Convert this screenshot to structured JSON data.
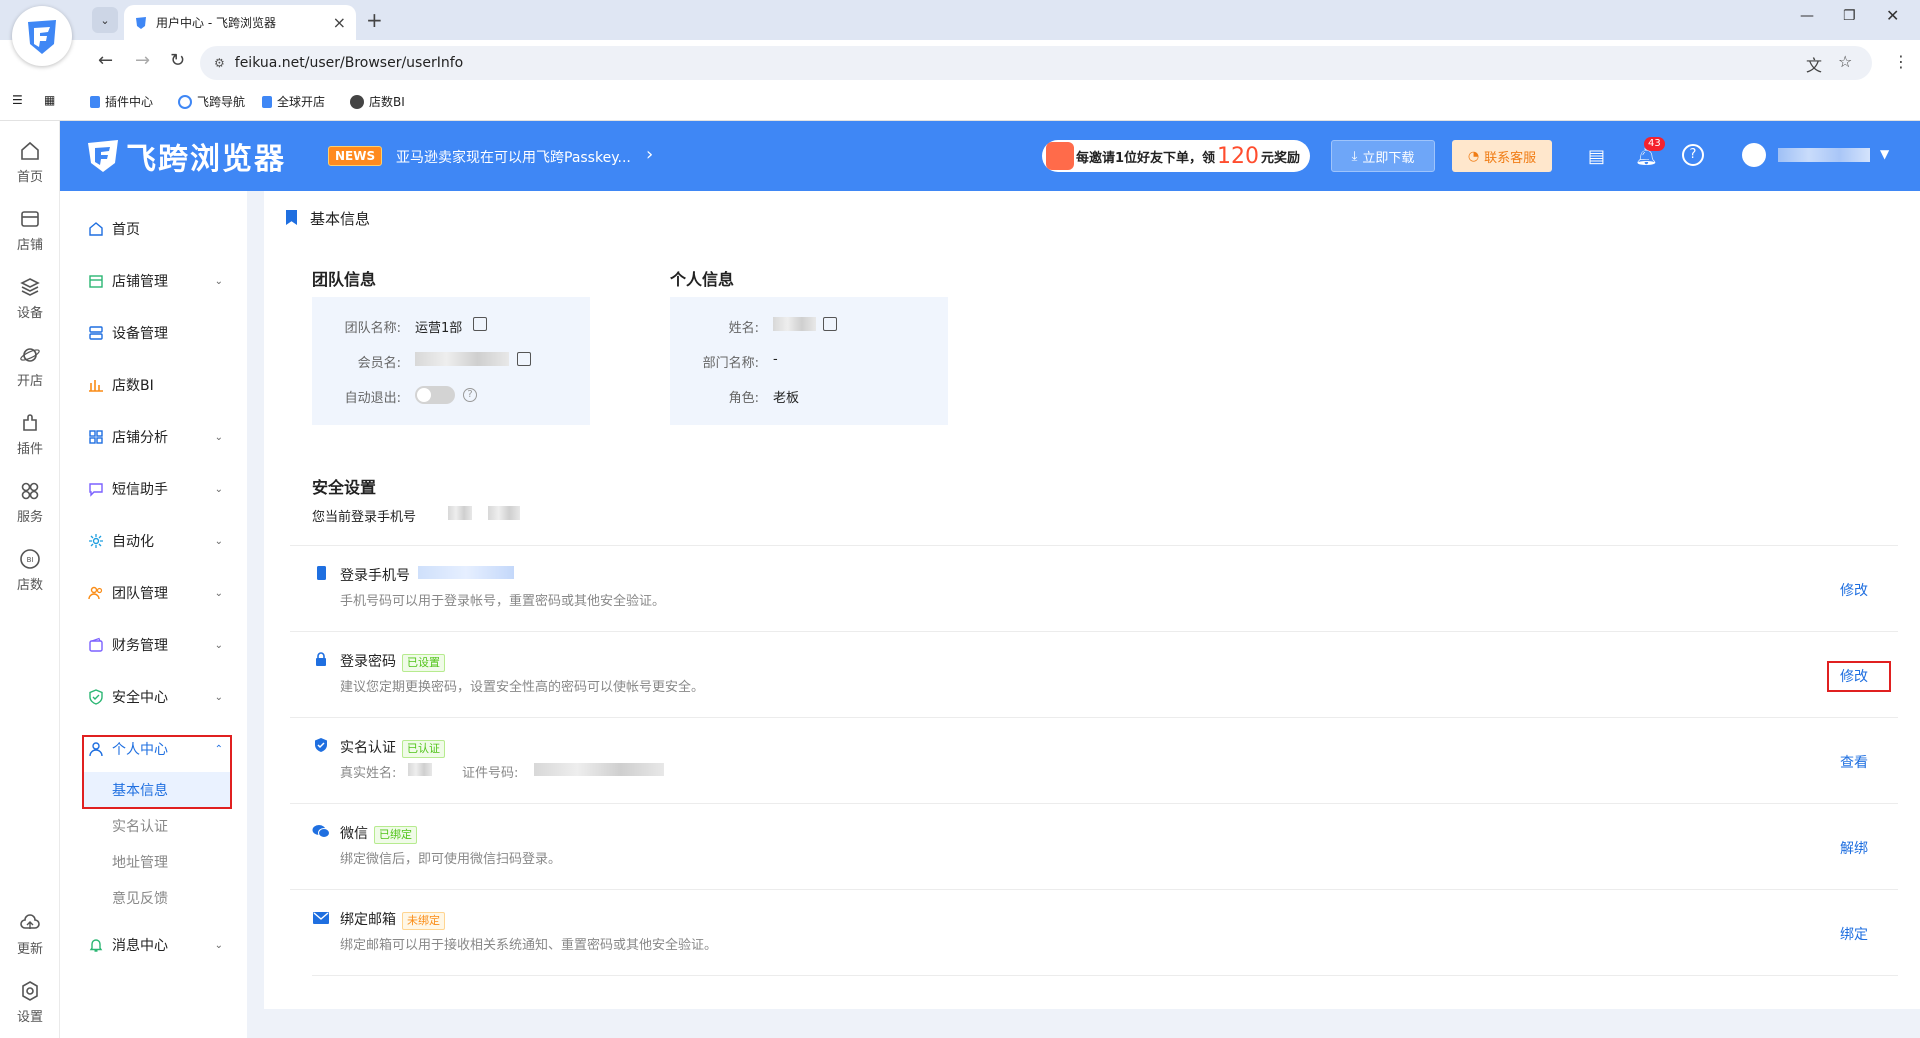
{
  "browser": {
    "tab_title": "用户中心 - 飞跨浏览器",
    "url": "feikua.net/user/Browser/userInfo",
    "bookmarks": [
      "插件中心",
      "飞跨导航",
      "全球开店",
      "店数BI"
    ]
  },
  "rail": [
    {
      "label": "首页",
      "icon": "home-icon"
    },
    {
      "label": "店铺",
      "icon": "store-icon"
    },
    {
      "label": "设备",
      "icon": "layers-icon"
    },
    {
      "label": "开店",
      "icon": "planet-icon"
    },
    {
      "label": "插件",
      "icon": "puzzle-icon"
    },
    {
      "label": "服务",
      "icon": "grid-icon"
    },
    {
      "label": "店数",
      "icon": "bi-icon"
    },
    {
      "label": "更新",
      "icon": "cloud-icon"
    },
    {
      "label": "设置",
      "icon": "settings-icon"
    }
  ],
  "header": {
    "brand": "飞跨浏览器",
    "news_badge": "NEWS",
    "news_text": "亚马逊卖家现在可以用飞跨Passkey...",
    "invite_prefix": "每邀请1位好友下单，领",
    "invite_amount": "120",
    "invite_suffix": "元奖励",
    "download_label": "立即下载",
    "service_label": "联系客服",
    "notification_count": "43"
  },
  "sidebar": {
    "items": [
      {
        "label": "首页",
        "icon": "home-icon",
        "caret": false
      },
      {
        "label": "店铺管理",
        "icon": "shop-icon",
        "caret": true
      },
      {
        "label": "设备管理",
        "icon": "server-icon",
        "caret": false
      },
      {
        "label": "店数BI",
        "icon": "chart-icon",
        "caret": false
      },
      {
        "label": "店铺分析",
        "icon": "apps-icon",
        "caret": true
      },
      {
        "label": "短信助手",
        "icon": "message-icon",
        "caret": true
      },
      {
        "label": "自动化",
        "icon": "automation-icon",
        "caret": true
      },
      {
        "label": "团队管理",
        "icon": "team-icon",
        "caret": true
      },
      {
        "label": "财务管理",
        "icon": "wallet-icon",
        "caret": true
      },
      {
        "label": "安全中心",
        "icon": "shield-icon",
        "caret": true
      },
      {
        "label": "个人中心",
        "icon": "user-icon",
        "caret": true
      },
      {
        "label": "消息中心",
        "icon": "bell-icon",
        "caret": true
      }
    ],
    "personal_sub": [
      "基本信息",
      "实名认证",
      "地址管理",
      "意见反馈"
    ]
  },
  "page": {
    "title": "基本信息",
    "team": {
      "title": "团队信息",
      "team_name_label": "团队名称:",
      "team_name_value": "运营1部",
      "member_label": "会员名:",
      "auto_logout_label": "自动退出:"
    },
    "personal": {
      "title": "个人信息",
      "name_label": "姓名:",
      "dept_label": "部门名称:",
      "dept_value": "-",
      "role_label": "角色:",
      "role_value": "老板"
    },
    "security": {
      "title": "安全设置",
      "current_phone": "您当前登录手机号",
      "rows": [
        {
          "title": "登录手机号",
          "tag": "",
          "desc": "手机号码可以用于登录帐号，重置密码或其他安全验证。",
          "action": "修改",
          "icon": "phone-icon"
        },
        {
          "title": "登录密码",
          "tag": "已设置",
          "desc": "建议您定期更换密码，设置安全性高的密码可以使帐号更安全。",
          "action": "修改",
          "icon": "lock-icon"
        },
        {
          "title": "实名认证",
          "tag": "已认证",
          "desc_name": "真实姓名:",
          "desc_id": "证件号码:",
          "action": "查看",
          "icon": "verify-icon"
        },
        {
          "title": "微信",
          "tag": "已绑定",
          "desc": "绑定微信后，即可使用微信扫码登录。",
          "action": "解绑",
          "icon": "wechat-icon"
        },
        {
          "title": "绑定邮箱",
          "tag": "未绑定",
          "desc": "绑定邮箱可以用于接收相关系统通知、重置密码或其他安全验证。",
          "action": "绑定",
          "icon": "mail-icon"
        }
      ]
    }
  },
  "colors": {
    "primary": "#3f87f5",
    "link": "#1f6fe0",
    "highlight": "#e02020"
  }
}
